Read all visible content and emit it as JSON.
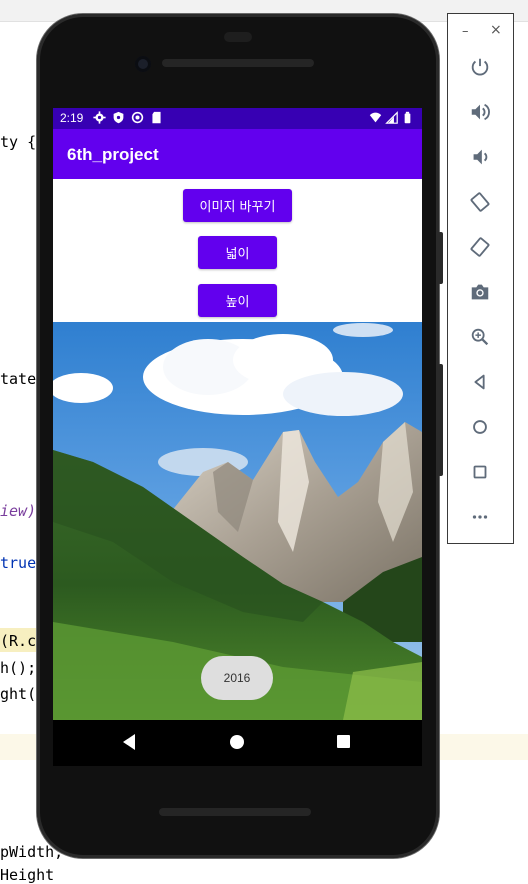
{
  "ide": {
    "code_fragments": [
      "ty {",
      "tate",
      "iew)",
      "true",
      "(R.c",
      "h();",
      "ght(",
      "pWidth,",
      "Height"
    ]
  },
  "status_bar": {
    "time": "2:19",
    "icons_left": [
      "settings-icon",
      "shield-icon",
      "blocked-icon",
      "sd-card-icon"
    ],
    "icons_right": [
      "wifi-icon",
      "cell-signal-icon",
      "battery-icon"
    ]
  },
  "app_bar": {
    "title": "6th_project"
  },
  "buttons": {
    "change_image": "이미지 바꾸기",
    "width": "넓이",
    "height": "높이"
  },
  "toast": {
    "text": "2016"
  },
  "nav_bar": {
    "items": [
      "back",
      "home",
      "recents"
    ]
  },
  "emulator_panel": {
    "window_controls": [
      "–",
      "×"
    ],
    "tools": [
      "power",
      "volume-up",
      "volume-down",
      "rotate-left",
      "rotate-right",
      "screenshot",
      "zoom",
      "back",
      "home",
      "overview",
      "more"
    ]
  },
  "colors": {
    "status_bar": "#3700b3",
    "app_bar": "#6200ee",
    "button": "#6200ee"
  }
}
